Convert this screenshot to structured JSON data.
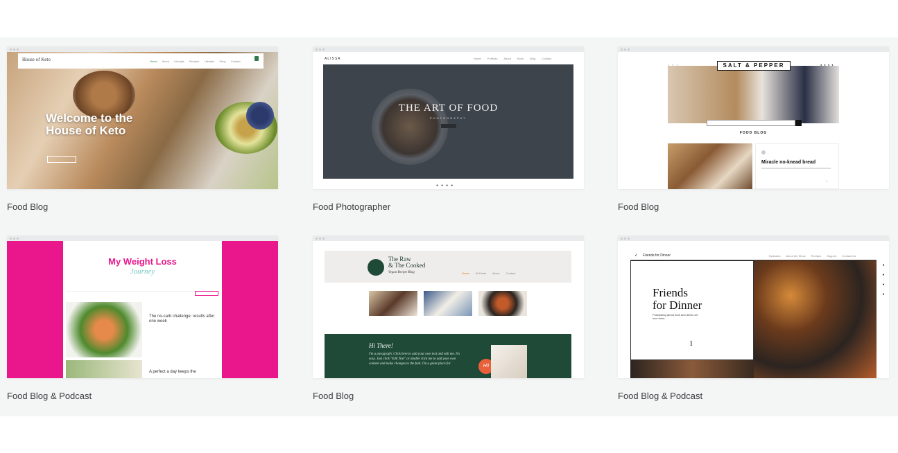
{
  "cards": [
    {
      "label": "Food Blog",
      "preview": {
        "site_title": "House of Keto",
        "hero_heading": "Welcome to the House of Keto",
        "nav": [
          "Home",
          "About",
          "Lifestyle",
          "Recipes",
          "Lifestyle",
          "Shop",
          "Contact"
        ]
      }
    },
    {
      "label": "Food Photographer",
      "preview": {
        "brand": "ALISSA",
        "hero_heading": "THE ART OF FOOD",
        "hero_sub": "PHOTOGRAPHY",
        "nav": [
          "Home",
          "Portfolio",
          "About",
          "Book",
          "Blog",
          "Contact"
        ]
      }
    },
    {
      "label": "Food Blog",
      "preview": {
        "logo": "SALT & PEPPER",
        "section": "FOOD BLOG",
        "post_title": "Miracle no-knead bread"
      }
    },
    {
      "label": "Food Blog & Podcast",
      "preview": {
        "title": "My Weight Loss",
        "subtitle": "Journey",
        "post_title": "The no-carb challenge: results after one week",
        "post_title_2": "A perfect a day keeps the"
      }
    },
    {
      "label": "Food Blog",
      "preview": {
        "title_line1": "The Raw",
        "title_line2": "& The Cooked",
        "tagline": "Vegan Recipe Blog",
        "nav": [
          "Home",
          "All Posts",
          "About",
          "Contact"
        ],
        "greeting": "Hi There!",
        "paragraph": "I'm a paragraph. Click here to add your own text and edit me. It's easy. Just click \"Edit Text\" or double click me to add your own content and make changes to the font. I'm a great place for",
        "badge": "Hi!"
      }
    },
    {
      "label": "Food Blog & Podcast",
      "preview": {
        "brand": "Friends for Dinner",
        "hero_heading_1": "Friends",
        "hero_heading_2": "for Dinner",
        "hero_text": "Podcasting about food and drinks we love them.",
        "episode": "1",
        "nav": [
          "Episodes",
          "About the Show",
          "Recipes",
          "Support",
          "Contact Us"
        ]
      }
    }
  ],
  "colors": {
    "band": "#f4f5f5",
    "pink": "#e9168c",
    "green": "#1f4a37"
  }
}
